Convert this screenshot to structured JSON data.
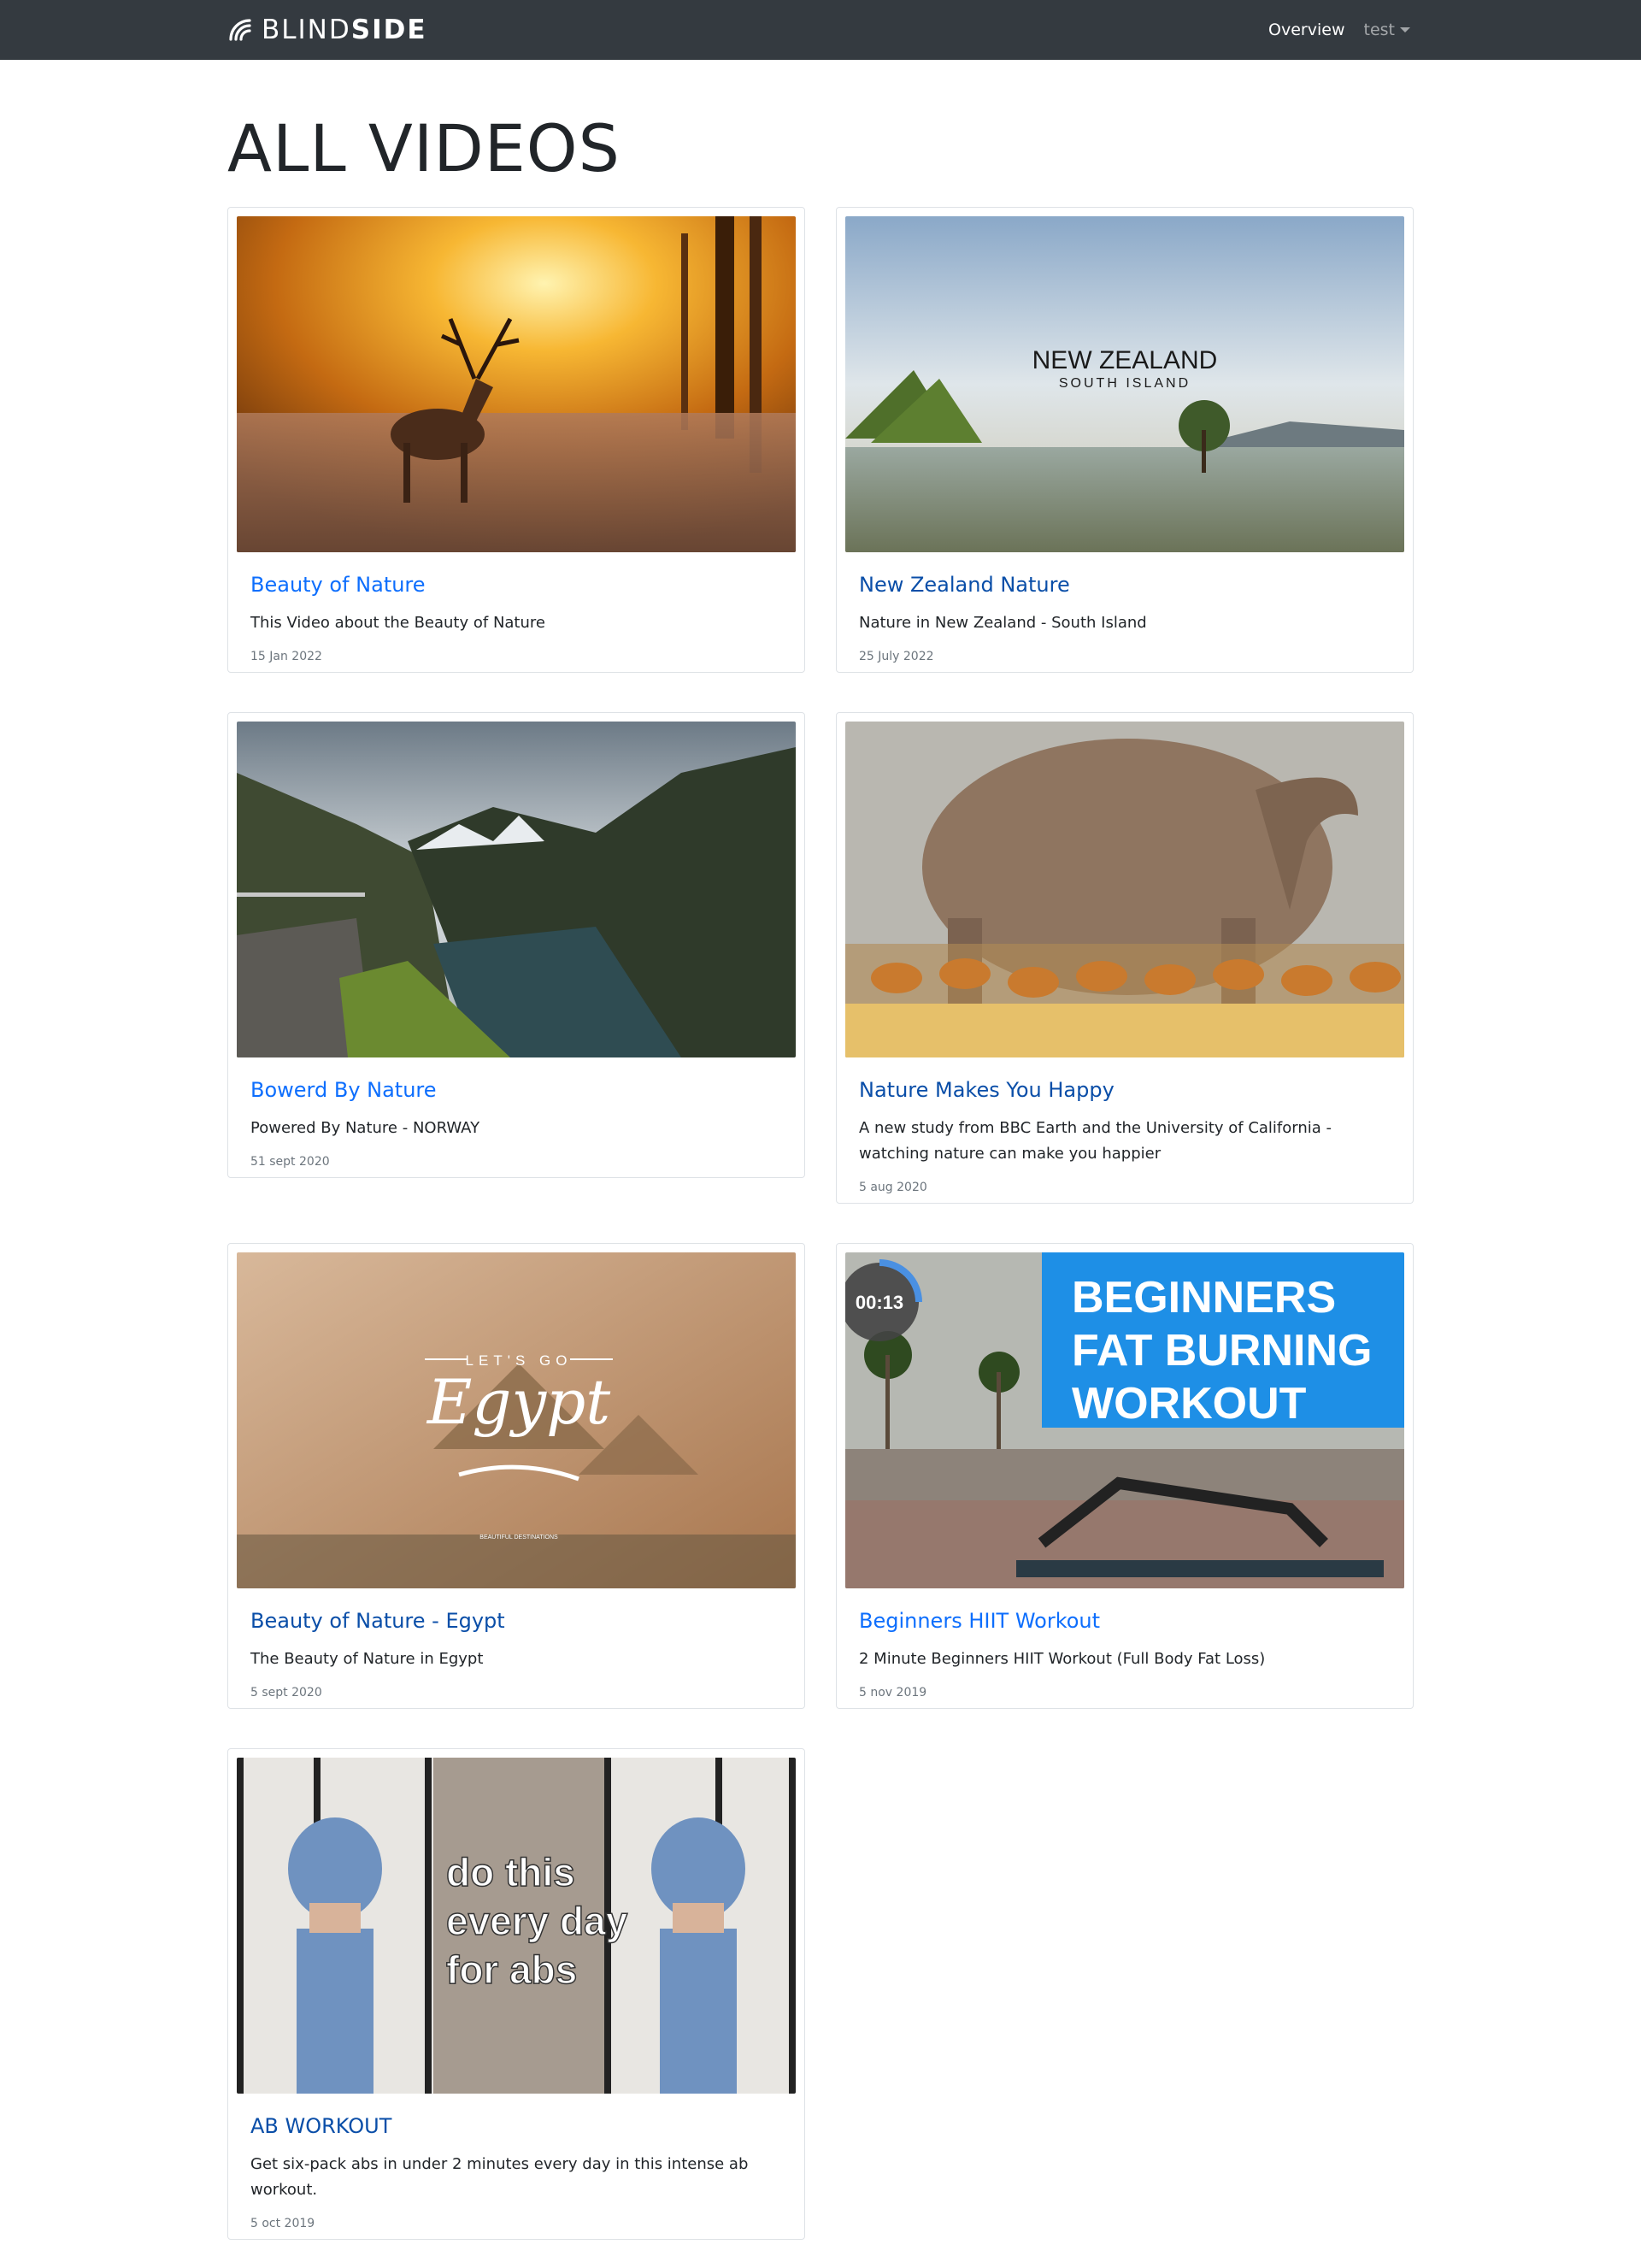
{
  "navbar": {
    "brand_plain": "BLIND",
    "brand_bold": "SIDE",
    "overview_label": "Overview",
    "user_label": "test"
  },
  "page": {
    "title": "ALL VIDEOS"
  },
  "videos": [
    {
      "title": "Beauty of Nature",
      "description": "This Video about the Beauty of Nature",
      "date": "15 Jan 2022"
    },
    {
      "title": "New Zealand Nature",
      "description": "Nature in New Zealand - South Island",
      "date": "25 July 2022",
      "thumb_title": "NEW ZEALAND",
      "thumb_subtitle": "SOUTH ISLAND"
    },
    {
      "title": "Bowerd By Nature",
      "description": "Powered By Nature - NORWAY",
      "date": "51 sept 2020"
    },
    {
      "title": "Nature Makes You Happy",
      "description": "A new study from BBC Earth and the University of California - watching nature can make you happier",
      "date": "5 aug 2020"
    },
    {
      "title": "Beauty of Nature - Egypt",
      "description": "The Beauty of Nature in Egypt",
      "date": "5 sept 2020",
      "thumb_top": "LET'S GO",
      "thumb_script": "Egypt",
      "thumb_caption": "BEAUTIFUL DESTINATIONS"
    },
    {
      "title": "Beginners HIIT Workout",
      "description": "2 Minute Beginners HIIT Workout (Full Body Fat Loss)",
      "date": "5 nov 2019",
      "thumb_timer": "00:13",
      "thumb_line1": "BEGINNERS",
      "thumb_line2": "FAT BURNING",
      "thumb_line3": "WORKOUT"
    },
    {
      "title": "AB WORKOUT",
      "description": "Get six-pack abs in under 2 minutes every day in this intense ab workout.",
      "date": "5 oct 2019",
      "thumb_line1": "do this",
      "thumb_line2": "every day",
      "thumb_line3": "for abs"
    }
  ]
}
